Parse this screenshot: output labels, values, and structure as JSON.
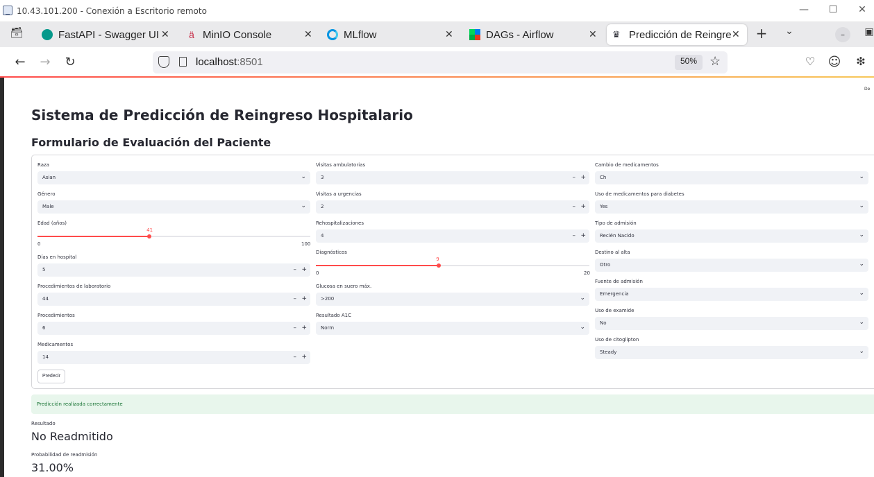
{
  "window": {
    "title": "10.43.101.200 - Conexión a Escritorio remoto"
  },
  "tabs": [
    {
      "label": "FastAPI - Swagger UI",
      "icon": "fastapi-icon",
      "color": "#05998b"
    },
    {
      "label": "MinIO Console",
      "icon": "minio-icon",
      "color": "#c72e49"
    },
    {
      "label": "MLflow",
      "icon": "mlflow-icon",
      "color": "#0194e2"
    },
    {
      "label": "DAGs - Airflow",
      "icon": "airflow-icon",
      "color": "#017cee"
    },
    {
      "label": "Predicción de Reingre",
      "icon": "streamlit-icon",
      "color": "#ff4b4b"
    }
  ],
  "url": {
    "host": "localhost",
    "port": ":8501",
    "zoom": "50%"
  },
  "app": {
    "deploy": "De",
    "title": "Sistema de Predicción de Reingreso Hospitalario",
    "subtitle": "Formulario de Evaluación del Paciente",
    "col1": {
      "raza": {
        "label": "Raza",
        "value": "Asian"
      },
      "genero": {
        "label": "Género",
        "value": "Male"
      },
      "edad": {
        "label": "Edad (años)",
        "value": 41,
        "min": "0",
        "max": "100",
        "fraction": 0.41
      },
      "dias": {
        "label": "Días en hospital",
        "value": "5"
      },
      "lab": {
        "label": "Procedimientos de laboratorio",
        "value": "44"
      },
      "proc": {
        "label": "Procedimientos",
        "value": "6"
      },
      "med": {
        "label": "Medicamentos",
        "value": "14"
      }
    },
    "col2": {
      "amb": {
        "label": "Visitas ambulatorias",
        "value": "3"
      },
      "urg": {
        "label": "Visitas a urgencias",
        "value": "2"
      },
      "rehosp": {
        "label": "Rehospitalizaciones",
        "value": "4"
      },
      "diag": {
        "label": "Diagnósticos",
        "value": 9,
        "min": "0",
        "max": "20",
        "fraction": 0.45
      },
      "glucosa": {
        "label": "Glucosa en suero máx.",
        "value": ">200"
      },
      "a1c": {
        "label": "Resultado A1C",
        "value": "Norm"
      }
    },
    "col3": {
      "cambio": {
        "label": "Cambio de medicamentos",
        "value": "Ch"
      },
      "diabetes": {
        "label": "Uso de medicamentos para diabetes",
        "value": "Yes"
      },
      "tipo": {
        "label": "Tipo de admisión",
        "value": "Recién Nacido"
      },
      "destino": {
        "label": "Destino al alta",
        "value": "Otro"
      },
      "fuente": {
        "label": "Fuente de admisión",
        "value": "Emergencia"
      },
      "examide": {
        "label": "Uso de examide",
        "value": "No"
      },
      "citoglipton": {
        "label": "Uso de citoglipton",
        "value": "Steady"
      }
    },
    "predict_label": "Predecir",
    "success": "Predicción realizada correctamente",
    "result": {
      "label": "Resultado",
      "value": "No Readmitido"
    },
    "prob": {
      "label": "Probabilidad de readmisión",
      "value": "31.00%"
    }
  }
}
